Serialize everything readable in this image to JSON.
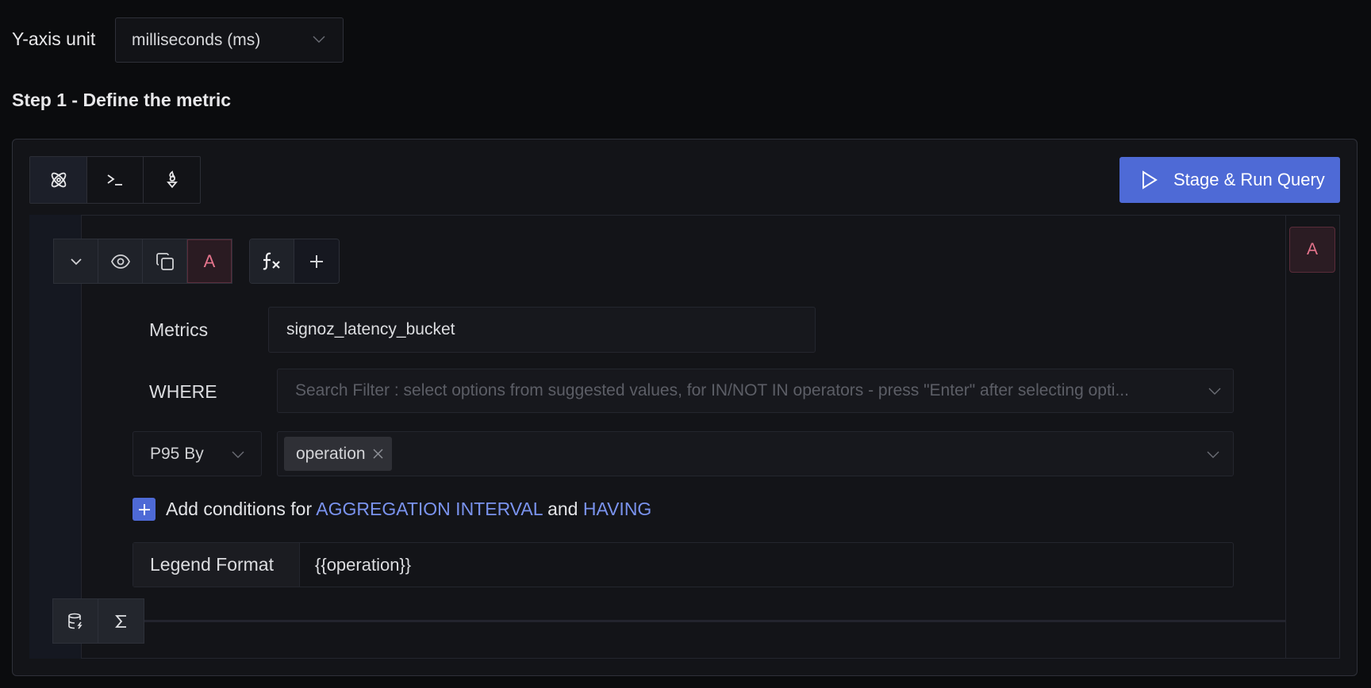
{
  "yaxis": {
    "label": "Y-axis unit",
    "selected_unit": "milliseconds (ms)"
  },
  "step_title": "Step 1 - Define the metric",
  "query_type_tabs": [
    {
      "icon": "atom-icon",
      "name": "query-builder",
      "active": true
    },
    {
      "icon": "terminal-icon",
      "name": "clickhouse-query",
      "active": false
    },
    {
      "icon": "promql-icon",
      "name": "promql",
      "active": false
    }
  ],
  "run_button": {
    "label": "Stage & Run Query",
    "icon": "play-icon"
  },
  "query": {
    "name": "A",
    "actions": [
      "chevron-down-icon",
      "eye-icon",
      "copy-icon"
    ],
    "formula_icon": "function-icon",
    "add_icon": "plus-icon",
    "metrics_label": "Metrics",
    "metrics_value": "signoz_latency_bucket",
    "where_label": "WHERE",
    "where_placeholder": "Search Filter : select options from suggested values, for IN/NOT IN operators - press \"Enter\" after selecting opti...",
    "aggregation": "P95 By",
    "group_by_tags": [
      "operation"
    ],
    "add_conditions": {
      "prefix": "Add conditions for",
      "link1": "AGGREGATION INTERVAL",
      "middle": "and",
      "link2": "HAVING"
    },
    "legend_label": "Legend Format",
    "legend_value": "{{operation}}"
  },
  "bottom_actions": [
    "database-icon",
    "sigma-icon"
  ],
  "colors": {
    "accent": "#4e6ad6",
    "link": "#7a93ee",
    "query_badge": "#e5748c"
  }
}
